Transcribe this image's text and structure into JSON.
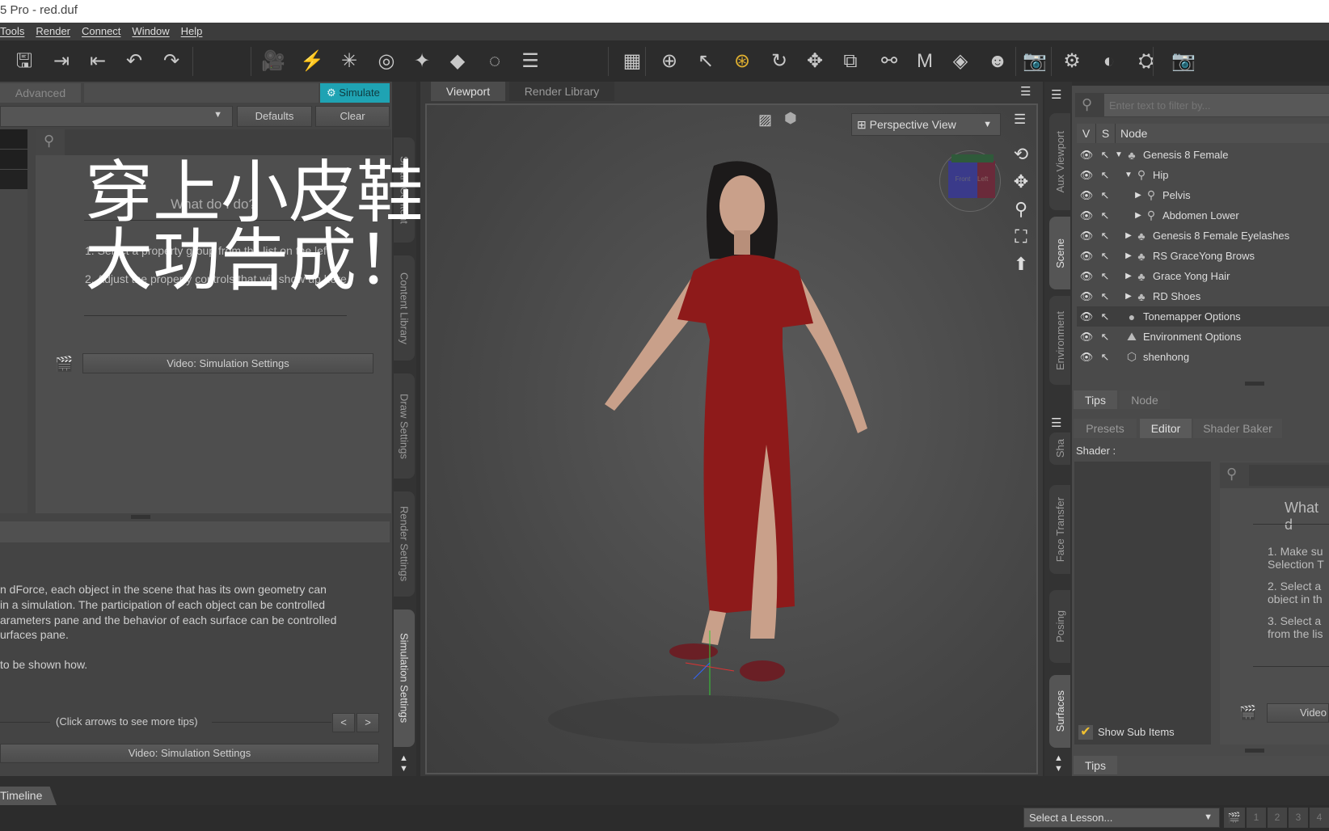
{
  "window": {
    "title": "5 Pro - red.duf"
  },
  "menu": [
    "Tools",
    "Render",
    "Connect",
    "Window",
    "Help"
  ],
  "toolbar": {
    "icons": [
      "save-icon",
      "import-icon",
      "export-icon",
      "undo-icon",
      "redo-icon",
      "new-camera-icon",
      "new-distant-light-icon",
      "new-point-light-icon",
      "new-spotlight-icon",
      "new-linear-point-light-icon",
      "new-primitive-icon",
      "new-null-icon",
      "align-icon",
      "pixel-grid-icon",
      "universal-tool-icon",
      "node-selection-icon",
      "active-pose-tool-icon",
      "rotate-tool-icon",
      "translate-tool-icon",
      "scale-tool-icon",
      "joint-editor-icon",
      "geometry-editor-icon",
      "surface-selection-icon",
      "figure-setup-icon",
      "render-icon",
      "render-settings-icon",
      "spot-render-icon",
      "iray-render-icon",
      "render-camera-icon"
    ],
    "active_color": "#e0b030"
  },
  "left_panel": {
    "tabs": {
      "advanced": "Advanced",
      "simulate": "Simulate"
    },
    "simulate_color": "#1fa3b3",
    "defaults": "Defaults",
    "clear": "Clear",
    "what_title": "What do I do?",
    "steps": [
      "1. Select a property group from the list on the left.",
      "2. Adjust the property controls that will show up here."
    ],
    "video_button": "Video: Simulation Settings",
    "tips_text": [
      "n dForce, each object in the scene that has its own geometry can",
      " in a simulation. The participation of each object can be controlled",
      "arameters pane and the behavior of each surface can be controlled",
      "urfaces pane.",
      "to be shown how."
    ],
    "tips_nav": "(Click arrows to see more tips)",
    "prev": "<",
    "next": ">",
    "video_button2": "Video: Simulation Settings",
    "side_tabs": [
      "Smart Content",
      "Content Library",
      "Draw Settings",
      "Render Settings",
      "Simulation Settings"
    ]
  },
  "overlay": {
    "line1": "穿上小皮鞋",
    "line2": "大功告成！"
  },
  "viewport": {
    "tabs": [
      "Viewport",
      "Render Library"
    ],
    "view_select": "Perspective View",
    "cube_labels": [
      "Front",
      "Left"
    ]
  },
  "scene": {
    "filter_placeholder": "Enter text to filter by...",
    "headers": [
      "V",
      "S",
      "Node"
    ],
    "nodes": [
      {
        "label": "Genesis 8 Female",
        "depth": 0,
        "expander": "open",
        "icon": "figure-icon"
      },
      {
        "label": "Hip",
        "depth": 1,
        "expander": "open",
        "icon": "bone-icon"
      },
      {
        "label": "Pelvis",
        "depth": 2,
        "expander": "closed",
        "icon": "bone-icon"
      },
      {
        "label": "Abdomen Lower",
        "depth": 2,
        "expander": "closed",
        "icon": "bone-icon"
      },
      {
        "label": "Genesis 8 Female Eyelashes",
        "depth": 1,
        "expander": "closed",
        "icon": "figure-icon"
      },
      {
        "label": "RS GraceYong Brows",
        "depth": 1,
        "expander": "closed",
        "icon": "figure-icon"
      },
      {
        "label": "Grace Yong Hair",
        "depth": 1,
        "expander": "closed",
        "icon": "figure-icon"
      },
      {
        "label": "RD Shoes",
        "depth": 1,
        "expander": "closed",
        "icon": "figure-icon"
      },
      {
        "label": "Tonemapper Options",
        "depth": 0,
        "expander": "none",
        "icon": "tonemapper-icon",
        "selected": true
      },
      {
        "label": "Environment Options",
        "depth": 0,
        "expander": "none",
        "icon": "environment-icon"
      },
      {
        "label": "shenhong",
        "depth": 0,
        "expander": "none",
        "icon": "prop-icon"
      }
    ],
    "bottom_tabs": [
      "Tips",
      "Node"
    ],
    "side_tabs": [
      "Aux Viewport",
      "Scene",
      "Environment"
    ]
  },
  "surfaces": {
    "tabs": [
      "Presets",
      "Editor",
      "Shader Baker"
    ],
    "shader_label": "Shader :",
    "what_title": "What d",
    "steps": [
      [
        "1. Make su",
        "Selection T"
      ],
      [
        "2. Select a",
        "object in th"
      ],
      [
        "3. Select a",
        "from the lis"
      ]
    ],
    "video": "Video",
    "show_sub_items": "Show Sub Items",
    "show_sub_items_checked": true,
    "tips": "Tips",
    "side_tabs": [
      "Sha",
      "Face Transfer",
      "Posing",
      "Surfaces"
    ]
  },
  "bottom": {
    "timeline": "Timeline",
    "lesson": "Select a Lesson...",
    "pages": [
      "1",
      "2",
      "3",
      "4"
    ]
  }
}
